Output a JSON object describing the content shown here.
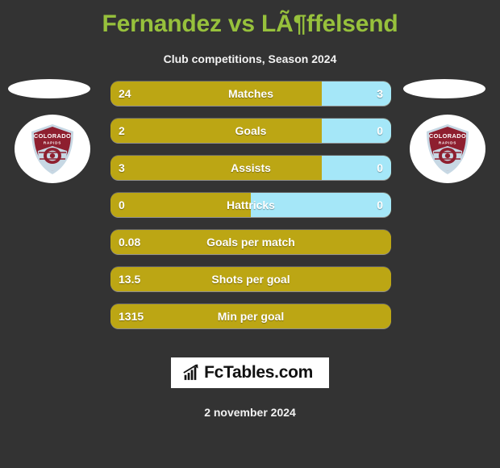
{
  "header": {
    "title": "Fernandez vs LÃ¶ffelsend",
    "subtitle": "Club competitions, Season 2024",
    "title_color": "#97c13c"
  },
  "teams": {
    "home": {
      "badge_name": "Colorado Rapids",
      "badge_text_top": "COLORADO",
      "badge_text_bottom": "RAPIDS"
    },
    "away": {
      "badge_name": "Colorado Rapids",
      "badge_text_top": "COLORADO",
      "badge_text_bottom": "RAPIDS"
    }
  },
  "colors": {
    "background": "#333333",
    "home_bar": "#bca614",
    "away_bar": "#a5e7f8",
    "text": "#ffffff",
    "accent_green": "#97c13c"
  },
  "chart_data": {
    "type": "bar",
    "title": "Fernandez vs LÃ¶ffelsend",
    "subtitle": "Club competitions, Season 2024",
    "orientation": "horizontal-diverging",
    "legend": [
      "Fernandez",
      "LÃ¶ffelsend"
    ],
    "categories": [
      "Matches",
      "Goals",
      "Assists",
      "Hattricks",
      "Goals per match",
      "Shots per goal",
      "Min per goal"
    ],
    "series": [
      {
        "name": "Fernandez",
        "values": [
          "24",
          "2",
          "3",
          "0",
          "0.08",
          "13.5",
          "1315"
        ]
      },
      {
        "name": "LÃ¶ffelsend",
        "values": [
          "3",
          "0",
          "0",
          "0",
          null,
          null,
          null
        ]
      }
    ]
  },
  "rows": [
    {
      "label": "Matches",
      "home": "24",
      "away": "3",
      "home_pct": 75.3,
      "two_sided": true
    },
    {
      "label": "Goals",
      "home": "2",
      "away": "0",
      "home_pct": 75.3,
      "two_sided": true
    },
    {
      "label": "Assists",
      "home": "3",
      "away": "0",
      "home_pct": 75.3,
      "two_sided": true
    },
    {
      "label": "Hattricks",
      "home": "0",
      "away": "0",
      "home_pct": 50.0,
      "two_sided": true
    },
    {
      "label": "Goals per match",
      "home": "0.08",
      "away": "",
      "home_pct": 100,
      "two_sided": false
    },
    {
      "label": "Shots per goal",
      "home": "13.5",
      "away": "",
      "home_pct": 100,
      "two_sided": false
    },
    {
      "label": "Min per goal",
      "home": "1315",
      "away": "",
      "home_pct": 100,
      "two_sided": false
    }
  ],
  "footer": {
    "brand": "FcTables.com",
    "brand_icon": "bar-chart-icon",
    "date": "2 november 2024"
  }
}
